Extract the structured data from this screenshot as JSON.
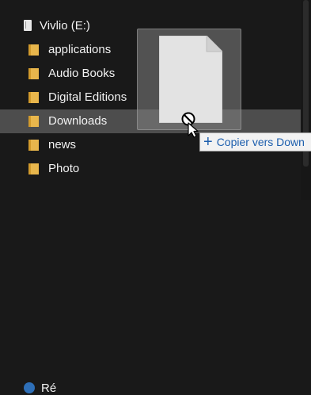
{
  "drive": {
    "label": "Vivlio (E:)"
  },
  "folders": [
    {
      "label": "applications",
      "selected": false
    },
    {
      "label": "Audio Books",
      "selected": false
    },
    {
      "label": "Digital Editions",
      "selected": false
    },
    {
      "label": "Downloads",
      "selected": true
    },
    {
      "label": "news",
      "selected": false
    },
    {
      "label": "Photo",
      "selected": false
    }
  ],
  "partial_item": {
    "label": "Ré"
  },
  "drag": {
    "tooltip_icon": "plus-icon",
    "tooltip_text": "Copier vers Down",
    "cursor": "no-drop-cursor"
  },
  "colors": {
    "background": "#191919",
    "selection": "#4d4d4d",
    "folder": "#e8b64c",
    "tooltip_text": "#1d5fae"
  }
}
